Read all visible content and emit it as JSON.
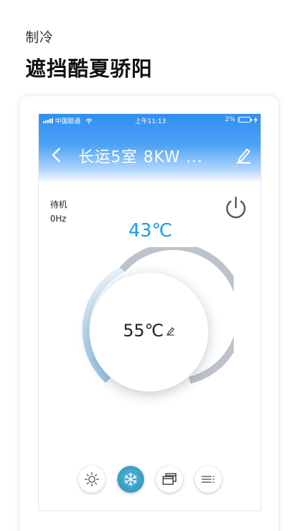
{
  "promo": {
    "mode_label": "制冷",
    "headline": "遮挡酷夏骄阳"
  },
  "statusbar": {
    "carrier": "中国联通",
    "time": "上午11:13",
    "battery_text": "2%",
    "battery_level": 0.02
  },
  "nav": {
    "title": "长运5室 8KW ..."
  },
  "device": {
    "state": "待机",
    "frequency": "0Hz",
    "current_temp": "43℃",
    "setpoint": "55℃"
  },
  "modes": [
    {
      "name": "heat",
      "icon": "sun-icon",
      "active": false
    },
    {
      "name": "cool",
      "icon": "snowflake-icon",
      "active": true
    },
    {
      "name": "window",
      "icon": "windows-icon",
      "active": false
    },
    {
      "name": "menu",
      "icon": "menu-list-icon",
      "active": false
    }
  ],
  "colors": {
    "accent": "#1b9ae6",
    "header_blue": "#2f8ff2",
    "active_mode": "#3a9fc8"
  }
}
